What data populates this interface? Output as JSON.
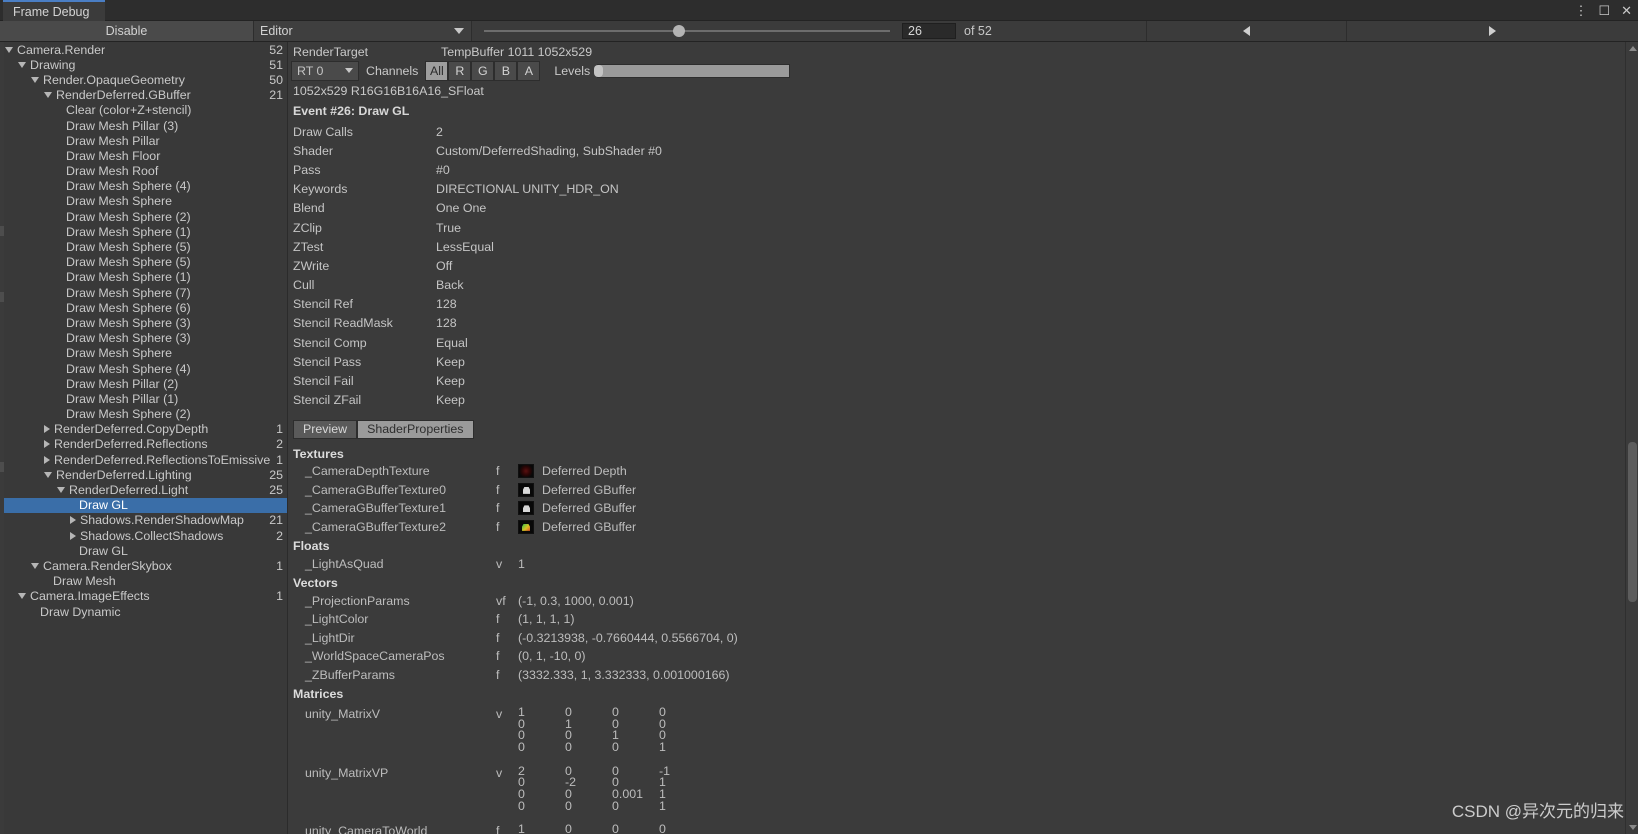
{
  "window": {
    "tab_title": "Frame Debug",
    "kebab_icon": "kebab-menu-icon",
    "maximize_icon": "maximize-icon",
    "close_icon": "close-icon"
  },
  "toolbar": {
    "disable_label": "Disable",
    "target_label": "Editor",
    "event_index": "26",
    "event_total_label": "of 52",
    "prev_icon": "triangle-left-icon",
    "next_icon": "triangle-right-icon"
  },
  "tree": {
    "nodes": [
      {
        "label": "Camera.Render",
        "depth": 0,
        "toggle": "down",
        "count": "52",
        "selected": false
      },
      {
        "label": "Drawing",
        "depth": 1,
        "toggle": "down",
        "count": "51",
        "selected": false
      },
      {
        "label": "Render.OpaqueGeometry",
        "depth": 2,
        "toggle": "down",
        "count": "50",
        "selected": false
      },
      {
        "label": "RenderDeferred.GBuffer",
        "depth": 3,
        "toggle": "down",
        "count": "21",
        "selected": false
      },
      {
        "label": "Clear (color+Z+stencil)",
        "depth": 4,
        "toggle": "none",
        "count": "",
        "selected": false
      },
      {
        "label": "Draw Mesh Pillar (3)",
        "depth": 4,
        "toggle": "none",
        "count": "",
        "selected": false
      },
      {
        "label": "Draw Mesh Pillar",
        "depth": 4,
        "toggle": "none",
        "count": "",
        "selected": false
      },
      {
        "label": "Draw Mesh Floor",
        "depth": 4,
        "toggle": "none",
        "count": "",
        "selected": false
      },
      {
        "label": "Draw Mesh Roof",
        "depth": 4,
        "toggle": "none",
        "count": "",
        "selected": false
      },
      {
        "label": "Draw Mesh Sphere (4)",
        "depth": 4,
        "toggle": "none",
        "count": "",
        "selected": false
      },
      {
        "label": "Draw Mesh Sphere",
        "depth": 4,
        "toggle": "none",
        "count": "",
        "selected": false
      },
      {
        "label": "Draw Mesh Sphere (2)",
        "depth": 4,
        "toggle": "none",
        "count": "",
        "selected": false
      },
      {
        "label": "Draw Mesh Sphere (1)",
        "depth": 4,
        "toggle": "none",
        "count": "",
        "selected": false
      },
      {
        "label": "Draw Mesh Sphere (5)",
        "depth": 4,
        "toggle": "none",
        "count": "",
        "selected": false
      },
      {
        "label": "Draw Mesh Sphere (5)",
        "depth": 4,
        "toggle": "none",
        "count": "",
        "selected": false
      },
      {
        "label": "Draw Mesh Sphere (1)",
        "depth": 4,
        "toggle": "none",
        "count": "",
        "selected": false
      },
      {
        "label": "Draw Mesh Sphere (7)",
        "depth": 4,
        "toggle": "none",
        "count": "",
        "selected": false
      },
      {
        "label": "Draw Mesh Sphere (6)",
        "depth": 4,
        "toggle": "none",
        "count": "",
        "selected": false
      },
      {
        "label": "Draw Mesh Sphere (3)",
        "depth": 4,
        "toggle": "none",
        "count": "",
        "selected": false
      },
      {
        "label": "Draw Mesh Sphere (3)",
        "depth": 4,
        "toggle": "none",
        "count": "",
        "selected": false
      },
      {
        "label": "Draw Mesh Sphere",
        "depth": 4,
        "toggle": "none",
        "count": "",
        "selected": false
      },
      {
        "label": "Draw Mesh Sphere (4)",
        "depth": 4,
        "toggle": "none",
        "count": "",
        "selected": false
      },
      {
        "label": "Draw Mesh Pillar (2)",
        "depth": 4,
        "toggle": "none",
        "count": "",
        "selected": false
      },
      {
        "label": "Draw Mesh Pillar (1)",
        "depth": 4,
        "toggle": "none",
        "count": "",
        "selected": false
      },
      {
        "label": "Draw Mesh Sphere (2)",
        "depth": 4,
        "toggle": "none",
        "count": "",
        "selected": false
      },
      {
        "label": "RenderDeferred.CopyDepth",
        "depth": 3,
        "toggle": "right",
        "count": "1",
        "selected": false
      },
      {
        "label": "RenderDeferred.Reflections",
        "depth": 3,
        "toggle": "right",
        "count": "2",
        "selected": false
      },
      {
        "label": "RenderDeferred.ReflectionsToEmissive",
        "depth": 3,
        "toggle": "right",
        "count": "1",
        "selected": false
      },
      {
        "label": "RenderDeferred.Lighting",
        "depth": 3,
        "toggle": "down",
        "count": "25",
        "selected": false
      },
      {
        "label": "RenderDeferred.Light",
        "depth": 4,
        "toggle": "down",
        "count": "25",
        "selected": false
      },
      {
        "label": "Draw GL",
        "depth": 5,
        "toggle": "none",
        "count": "",
        "selected": true
      },
      {
        "label": "Shadows.RenderShadowMap",
        "depth": 5,
        "toggle": "right",
        "count": "21",
        "selected": false
      },
      {
        "label": "Shadows.CollectShadows",
        "depth": 5,
        "toggle": "right",
        "count": "2",
        "selected": false
      },
      {
        "label": "Draw GL",
        "depth": 5,
        "toggle": "none",
        "count": "",
        "selected": false
      },
      {
        "label": "Camera.RenderSkybox",
        "depth": 2,
        "toggle": "down",
        "count": "1",
        "selected": false
      },
      {
        "label": "Draw Mesh",
        "depth": 3,
        "toggle": "none",
        "count": "",
        "selected": false
      },
      {
        "label": "Camera.ImageEffects",
        "depth": 1,
        "toggle": "down",
        "count": "1",
        "selected": false
      },
      {
        "label": "Draw Dynamic",
        "depth": 2,
        "toggle": "none",
        "count": "",
        "selected": false
      }
    ]
  },
  "rendertarget": {
    "label": "RenderTarget",
    "value": "TempBuffer 1011 1052x529",
    "rt_select": "RT 0",
    "channels_label": "Channels",
    "channels": [
      {
        "label": "All",
        "active": true
      },
      {
        "label": "R",
        "active": false
      },
      {
        "label": "G",
        "active": false
      },
      {
        "label": "B",
        "active": false
      },
      {
        "label": "A",
        "active": false
      }
    ],
    "levels_label": "Levels",
    "format": "1052x529 R16G16B16A16_SFloat"
  },
  "event": {
    "title": "Event #26: Draw GL",
    "properties": [
      {
        "key": "Draw Calls",
        "value": "2"
      },
      {
        "key": "Shader",
        "value": "Custom/DeferredShading, SubShader #0"
      },
      {
        "key": "Pass",
        "value": "#0"
      },
      {
        "key": "Keywords",
        "value": "DIRECTIONAL UNITY_HDR_ON"
      },
      {
        "key": "Blend",
        "value": "One One"
      },
      {
        "key": "ZClip",
        "value": "True"
      },
      {
        "key": "ZTest",
        "value": "LessEqual"
      },
      {
        "key": "ZWrite",
        "value": "Off"
      },
      {
        "key": "Cull",
        "value": "Back"
      },
      {
        "key": "Stencil Ref",
        "value": "128"
      },
      {
        "key": "Stencil ReadMask",
        "value": "128"
      },
      {
        "key": "Stencil Comp",
        "value": "Equal"
      },
      {
        "key": "Stencil Pass",
        "value": "Keep"
      },
      {
        "key": "Stencil Fail",
        "value": "Keep"
      },
      {
        "key": "Stencil ZFail",
        "value": "Keep"
      }
    ]
  },
  "tabs": [
    {
      "label": "Preview",
      "active": false
    },
    {
      "label": "ShaderProperties",
      "active": true
    }
  ],
  "shader_properties": {
    "textures_heading": "Textures",
    "textures": [
      {
        "name": "_CameraDepthTexture",
        "type": "f",
        "swatch": "depth",
        "value": "Deferred Depth"
      },
      {
        "name": "_CameraGBufferTexture0",
        "type": "f",
        "swatch": "gb0",
        "value": "Deferred GBuffer"
      },
      {
        "name": "_CameraGBufferTexture1",
        "type": "f",
        "swatch": "gb0",
        "value": "Deferred GBuffer"
      },
      {
        "name": "_CameraGBufferTexture2",
        "type": "f",
        "swatch": "gb2",
        "value": "Deferred GBuffer"
      }
    ],
    "floats_heading": "Floats",
    "floats": [
      {
        "name": "_LightAsQuad",
        "type": "v",
        "value": "1"
      }
    ],
    "vectors_heading": "Vectors",
    "vectors": [
      {
        "name": "_ProjectionParams",
        "type": "vf",
        "value": "(-1, 0.3, 1000, 0.001)"
      },
      {
        "name": "_LightColor",
        "type": "f",
        "value": "(1, 1, 1, 1)"
      },
      {
        "name": "_LightDir",
        "type": "f",
        "value": "(-0.3213938, -0.7660444, 0.5566704, 0)"
      },
      {
        "name": "_WorldSpaceCameraPos",
        "type": "f",
        "value": "(0, 1, -10, 0)"
      },
      {
        "name": "_ZBufferParams",
        "type": "f",
        "value": "(3332.333, 1, 3.332333, 0.001000166)"
      }
    ],
    "matrices_heading": "Matrices",
    "matrices": [
      {
        "name": "unity_MatrixV",
        "type": "v",
        "rows": [
          [
            "1",
            "0",
            "0",
            "0"
          ],
          [
            "0",
            "1",
            "0",
            "0"
          ],
          [
            "0",
            "0",
            "1",
            "0"
          ],
          [
            "0",
            "0",
            "0",
            "1"
          ]
        ]
      },
      {
        "name": "unity_MatrixVP",
        "type": "v",
        "rows": [
          [
            "2",
            "0",
            "0",
            "-1"
          ],
          [
            "0",
            "-2",
            "0",
            "1"
          ],
          [
            "0",
            "0",
            "0.001",
            "1"
          ],
          [
            "0",
            "0",
            "0",
            "1"
          ]
        ]
      },
      {
        "name": "unity_CameraToWorld",
        "type": "f",
        "rows": [
          [
            "1",
            "0",
            "0",
            "0"
          ]
        ]
      }
    ]
  },
  "watermark": "CSDN @异次元的归来"
}
